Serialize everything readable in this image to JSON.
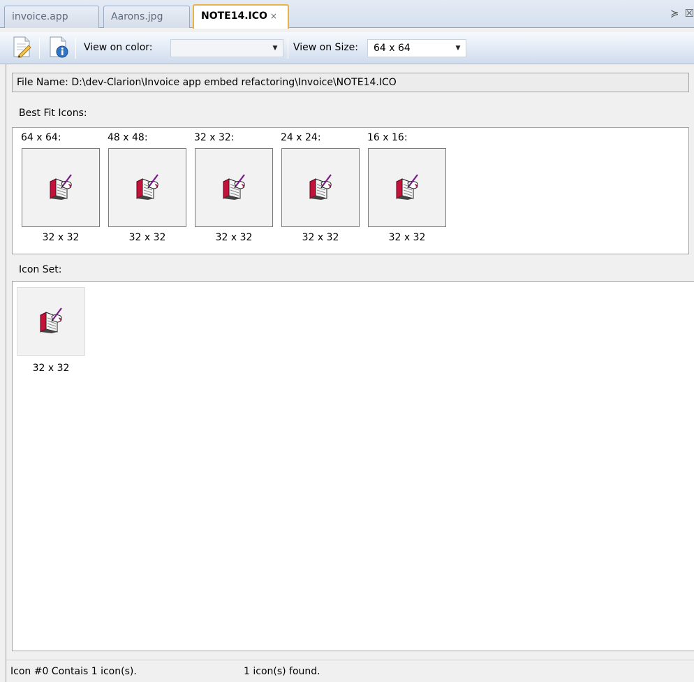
{
  "tabs": [
    {
      "label": "invoice.app",
      "active": false
    },
    {
      "label": "Aarons.jpg",
      "active": false
    },
    {
      "label": "NOTE14.ICO",
      "active": true,
      "close": "×"
    }
  ],
  "tabstrip_icons": {
    "menu": "≽",
    "close": "☒"
  },
  "toolbar": {
    "color_label": "View on color:",
    "color_value": "",
    "size_label": "View on Size:",
    "size_value": "64 x 64"
  },
  "file_name": "File Name: D:\\dev-Clarion\\Invoice app embed refactoring\\Invoice\\NOTE14.ICO",
  "best_fit": {
    "label": "Best Fit Icons:",
    "items": [
      {
        "header": "64 x 64:",
        "caption": "32 x 32"
      },
      {
        "header": "48 x 48:",
        "caption": "32 x 32"
      },
      {
        "header": "32 x 32:",
        "caption": "32 x 32"
      },
      {
        "header": "24 x 24:",
        "caption": "32 x 32"
      },
      {
        "header": "16 x 16:",
        "caption": "32 x 32"
      }
    ]
  },
  "icon_set": {
    "label": "Icon Set:",
    "items": [
      {
        "caption": "32 x 32"
      }
    ]
  },
  "status": {
    "left": "Icon #0 Contais 1 icon(s).",
    "right": "1 icon(s) found."
  }
}
